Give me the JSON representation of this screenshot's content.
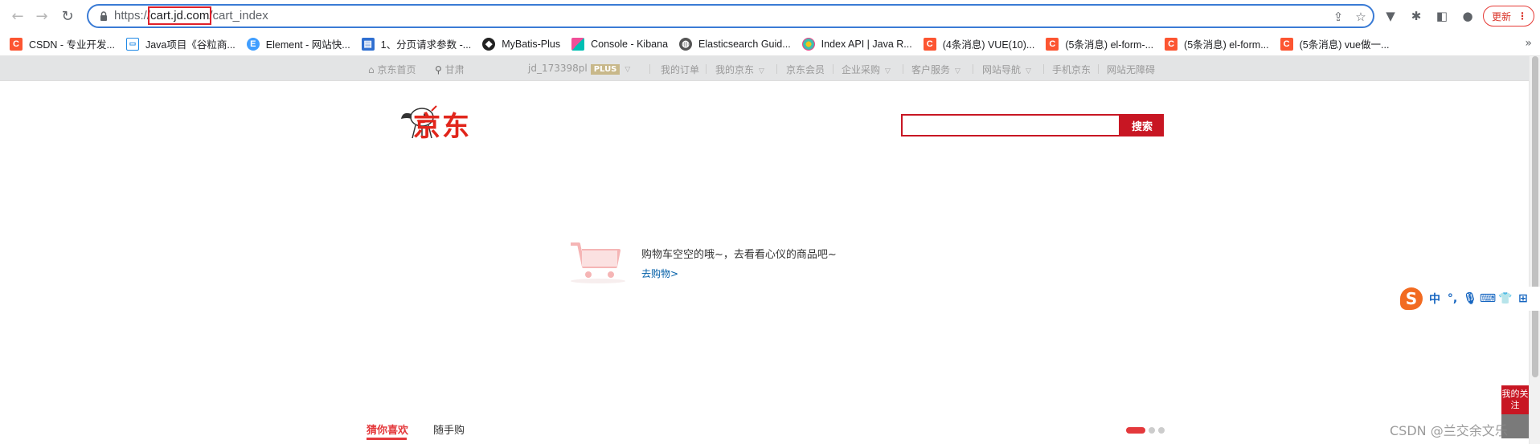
{
  "browser": {
    "url_protocol": "https://",
    "url_host": "cart.jd.com",
    "url_path": "/cart_index",
    "update_label": "更新",
    "update_menu": "⋮"
  },
  "bookmarks": [
    {
      "label": "CSDN - 专业开发...",
      "icon": "csdn-icon"
    },
    {
      "label": "Java项目《谷粒商...",
      "icon": "bilibili-icon"
    },
    {
      "label": "Element - 网站快...",
      "icon": "element-icon"
    },
    {
      "label": "1、分页请求参数 -...",
      "icon": "doc-icon"
    },
    {
      "label": "MyBatis-Plus",
      "icon": "mybatis-icon"
    },
    {
      "label": "Console - Kibana",
      "icon": "kibana-icon"
    },
    {
      "label": "Elasticsearch Guid...",
      "icon": "elastic-guide-icon"
    },
    {
      "label": "Index API | Java R...",
      "icon": "elastic-icon"
    },
    {
      "label": "(4条消息) VUE(10)...",
      "icon": "csdn-icon"
    },
    {
      "label": "(5条消息) el-form-...",
      "icon": "csdn-icon"
    },
    {
      "label": "(5条消息) el-form...",
      "icon": "csdn-icon"
    },
    {
      "label": "(5条消息) vue做一...",
      "icon": "csdn-icon"
    }
  ],
  "bookmarks_more": "»",
  "shortcut": {
    "home": "京东首页",
    "location": "甘肃",
    "user": "jd_173398pl",
    "plus": "PLUS",
    "orders": "我的订单",
    "my_jd": "我的京东",
    "member": "京东会员",
    "enterprise": "企业采购",
    "service": "客户服务",
    "nav": "网站导航",
    "mobile": "手机京东",
    "accessible": "网站无障碍"
  },
  "header": {
    "logo_text": "京东",
    "search_placeholder": "",
    "search_button": "搜索"
  },
  "cart": {
    "empty_message": "购物车空空的哦~，去看看心仪的商品吧~",
    "go_shopping": "去购物>"
  },
  "recommend": {
    "tab_guess": "猜你喜欢",
    "tab_random": "随手购"
  },
  "widgets": {
    "ime_mode": "中",
    "ime_punct": "°,",
    "follow_label": "我的关注",
    "watermark": "CSDN @兰交余文乐"
  },
  "colors": {
    "jd_red": "#e1251b",
    "search_red": "#c81623",
    "link_blue": "#005ea7",
    "omnibox_blue": "#3a7bd5"
  }
}
